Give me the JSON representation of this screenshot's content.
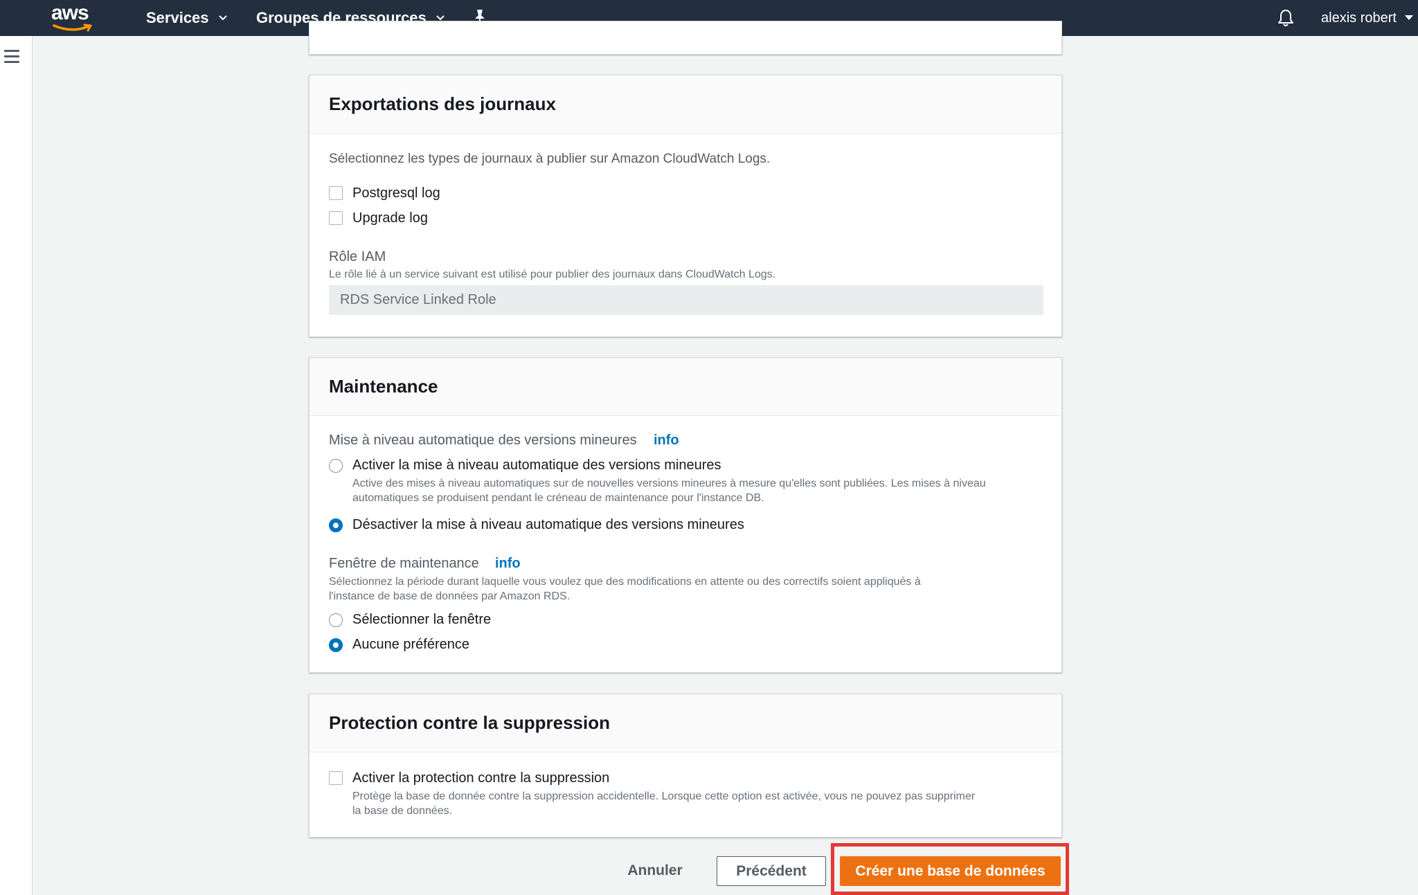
{
  "topbar": {
    "logo_text": "aws",
    "services_label": "Services",
    "resource_groups_label": "Groupes de ressources",
    "user_name": "alexis robert",
    "icons": [
      "aws-logo-icon",
      "chevron-down-icon",
      "pin-icon",
      "bell-icon",
      "menu-icon"
    ]
  },
  "logs_export": {
    "title": "Exportations des journaux",
    "description": "Sélectionnez les types de journaux à publier sur Amazon CloudWatch Logs.",
    "options": [
      {
        "label": "Postgresql log",
        "checked": false
      },
      {
        "label": "Upgrade log",
        "checked": false
      }
    ],
    "iam_role_label": "Rôle IAM",
    "iam_role_help": "Le rôle lié à un service suivant est utilisé pour publier des journaux dans CloudWatch Logs.",
    "iam_role_value": "RDS Service Linked Role"
  },
  "maintenance": {
    "title": "Maintenance",
    "auto_upgrade_label": "Mise à niveau automatique des versions mineures",
    "info_label": "info",
    "enable_option": "Activer la mise à niveau automatique des versions mineures",
    "enable_help_line1": "Active des mises à niveau automatiques sur de nouvelles versions mineures à mesure qu'elles sont publiées. Les mises à niveau",
    "enable_help_line2": "automatiques se produisent pendant le créneau de maintenance pour l'instance DB.",
    "disable_option": "Désactiver la mise à niveau automatique des versions mineures",
    "selected_upgrade": "disable",
    "window_label": "Fenêtre de maintenance",
    "window_help_line1": "Sélectionnez la période durant laquelle vous voulez que des modifications en attente ou des correctifs soient appliqués à",
    "window_help_line2": "l'instance de base de données par Amazon RDS.",
    "select_window_option": "Sélectionner la fenêtre",
    "no_preference_option": "Aucune préférence",
    "selected_window": "no_preference"
  },
  "deletion_protection": {
    "title": "Protection contre la suppression",
    "option": "Activer la protection contre la suppression",
    "checked": false,
    "help_line1": "Protège la base de donnée contre la suppression accidentelle. Lorsque cette option est activée, vous ne pouvez pas supprimer",
    "help_line2": "la base de données."
  },
  "footer": {
    "cancel_label": "Annuler",
    "previous_label": "Précédent",
    "create_label": "Créer une base de données"
  },
  "colors": {
    "topbar": "#232f3e",
    "primary_button": "#ec7211",
    "link": "#0073bb",
    "highlight_box": "#e53935"
  }
}
